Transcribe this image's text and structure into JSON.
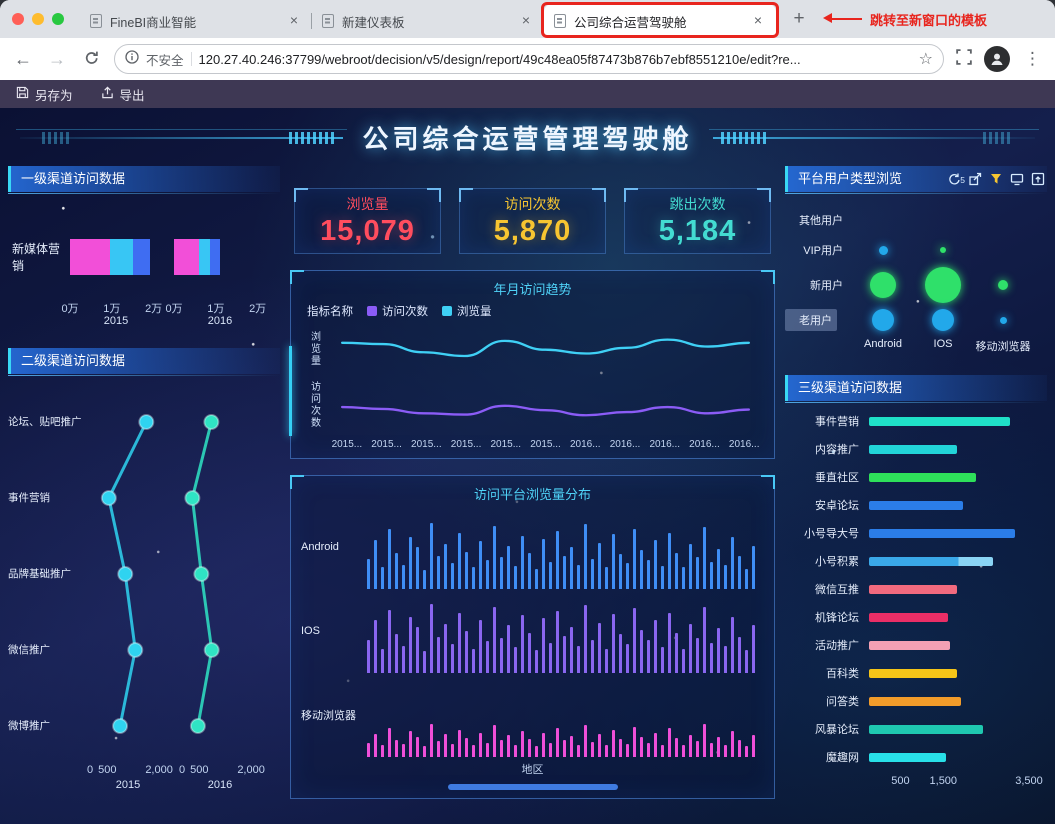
{
  "browser": {
    "window_controls": [
      "close",
      "minimize",
      "zoom"
    ],
    "tabs": [
      {
        "label": "FineBI商业智能",
        "active": false,
        "highlighted": false
      },
      {
        "label": "新建仪表板",
        "active": false,
        "highlighted": false
      },
      {
        "label": "公司综合运营驾驶舱",
        "active": true,
        "highlighted": true
      }
    ],
    "new_tab_label": "+",
    "annotation_text": "跳转至新窗口的模板",
    "address": {
      "security_label": "不安全",
      "url": "120.27.40.246:37799/webroot/decision/v5/design/report/49c48ea05f87473b876b7ebf8551210e/edit?re..."
    },
    "icons": [
      "back-icon",
      "forward-icon",
      "reload-icon",
      "info-icon",
      "bookmark-star-icon",
      "fullscreen-icon",
      "profile-avatar",
      "menu-icon"
    ]
  },
  "app_toolbar": {
    "save_as_label": "另存为",
    "export_label": "导出"
  },
  "dashboard": {
    "title": "公司综合运营管理驾驶舱",
    "kpis": [
      {
        "label": "浏览量",
        "value": "15,079",
        "color": "#ff4d5e"
      },
      {
        "label": "访问次数",
        "value": "5,870",
        "color": "#f7c531"
      },
      {
        "label": "跳出次数",
        "value": "5,184",
        "color": "#43dcd1"
      }
    ],
    "level1_panel": {
      "title": "一级渠道访问数据",
      "chart_data": {
        "type": "bar",
        "orientation": "horizontal",
        "stacked": true,
        "category": "新媒体营销",
        "xlim": [
          0,
          2.2
        ],
        "ticks": [
          {
            "label": "0万",
            "value": 0
          },
          {
            "label": "1万",
            "value": 1
          },
          {
            "label": "2万",
            "value": 2
          }
        ],
        "series_colors": [
          "#f24fd8",
          "#38c6f4",
          "#3f6df2"
        ],
        "groups": [
          {
            "year": "2015",
            "values": [
              0.95,
              0.55,
              0.42
            ]
          },
          {
            "year": "2016",
            "values": [
              0.6,
              0.26,
              0.24
            ]
          }
        ]
      }
    },
    "level2_panel": {
      "title": "二级渠道访问数据",
      "chart_data": {
        "type": "scatter",
        "categories": [
          "论坛、贴吧推广",
          "事件营销",
          "品牌基础推广",
          "微信推广",
          "微博推广"
        ],
        "xlim": [
          0,
          2200
        ],
        "ticks": [
          {
            "label": "0",
            "value": 0
          },
          {
            "label": "500",
            "value": 500
          },
          {
            "label": "2,000",
            "value": 2000
          }
        ],
        "series": [
          {
            "name": "2015",
            "color": "#2fd3f0",
            "values": [
              1630,
              545,
              1020,
              1310,
              870
            ]
          },
          {
            "name": "2016",
            "color": "#2fe4c4",
            "values": [
              850,
              300,
              560,
              860,
              460
            ]
          }
        ]
      }
    },
    "trend_panel": {
      "title": "年月访问趋势",
      "legend_title": "指标名称",
      "y_axis_labels": [
        "浏览量",
        "访问次数"
      ],
      "chart_data": {
        "type": "line",
        "x_labels": [
          "2015...",
          "2015...",
          "2015...",
          "2015...",
          "2015...",
          "2015...",
          "2016...",
          "2016...",
          "2016...",
          "2016...",
          "2016..."
        ],
        "ylim": [
          0,
          1600
        ],
        "series": [
          {
            "name": "访问次数",
            "color": "#8b5cf6",
            "values": [
              430,
              400,
              330,
              310,
              450,
              380,
              300,
              350,
              430,
              330,
              390
            ]
          },
          {
            "name": "浏览量",
            "color": "#3fd0f5",
            "values": [
              1450,
              1430,
              1300,
              1240,
              1480,
              1340,
              1280,
              1370,
              1500,
              1390,
              1450
            ]
          }
        ]
      }
    },
    "platform_panel": {
      "title": "访问平台浏览量分布",
      "xlabel": "地区",
      "chart_data": {
        "type": "bar",
        "value_unit": "relative height 0-100",
        "rows": [
          {
            "label": "Android",
            "color": "#3f8ef5",
            "values": [
              42,
              68,
              30,
              84,
              50,
              34,
              72,
              58,
              26,
              92,
              46,
              62,
              36,
              78,
              52,
              30,
              66,
              40,
              88,
              44,
              60,
              32,
              74,
              50,
              28,
              70,
              38,
              80,
              46,
              58,
              34,
              90,
              42,
              64,
              30,
              76,
              48,
              36,
              84,
              54,
              40,
              68,
              32,
              78,
              50,
              30,
              62,
              44,
              86,
              38,
              56,
              34,
              72,
              46,
              28,
              60
            ]
          },
          {
            "label": "IOS",
            "color": "#8a66f0",
            "values": [
              46,
              74,
              34,
              88,
              54,
              38,
              78,
              64,
              30,
              96,
              50,
              68,
              40,
              84,
              58,
              34,
              74,
              44,
              92,
              48,
              66,
              36,
              80,
              56,
              32,
              76,
              42,
              86,
              52,
              64,
              38,
              94,
              46,
              70,
              34,
              82,
              54,
              40,
              90,
              60,
              46,
              74,
              36,
              84,
              56,
              34,
              68,
              48,
              92,
              42,
              62,
              38,
              78,
              50,
              32,
              66
            ]
          },
          {
            "label": "移动浏览器",
            "color": "#ef4fd8",
            "values": [
              20,
              32,
              16,
              40,
              24,
              18,
              36,
              28,
              15,
              46,
              22,
              32,
              18,
              38,
              26,
              16,
              34,
              20,
              44,
              23,
              30,
              17,
              36,
              25,
              15,
              34,
              19,
              40,
              24,
              29,
              17,
              44,
              21,
              32,
              16,
              38,
              25,
              18,
              42,
              28,
              20,
              34,
              17,
              40,
              26,
              16,
              31,
              22,
              46,
              19,
              28,
              17,
              36,
              23,
              15,
              30
            ]
          }
        ]
      }
    },
    "user_type_panel": {
      "title": "平台用户类型浏览",
      "toolbar_icons": [
        {
          "name": "refresh-icon",
          "badge": "5"
        },
        {
          "name": "open-window-icon"
        },
        {
          "name": "filter-icon",
          "color": "#f5c531"
        },
        {
          "name": "export-icon"
        },
        {
          "name": "collapse-icon"
        }
      ],
      "chart_data": {
        "type": "scatter",
        "rows": [
          "其他用户",
          "VIP用户",
          "新用户",
          "老用户"
        ],
        "selected_row": "老用户",
        "cols": [
          "Android",
          "IOS",
          "移动浏览器"
        ],
        "bubbles": [
          {
            "row": 1,
            "col": 0,
            "size": 9,
            "color": "#22a8ea"
          },
          {
            "row": 1,
            "col": 1,
            "size": 6,
            "color": "#2fe06a"
          },
          {
            "row": 2,
            "col": 0,
            "size": 26,
            "color": "#2fe06a"
          },
          {
            "row": 2,
            "col": 1,
            "size": 36,
            "color": "#2fe06a"
          },
          {
            "row": 2,
            "col": 2,
            "size": 10,
            "color": "#2fe06a"
          },
          {
            "row": 3,
            "col": 0,
            "size": 22,
            "color": "#22a8ea"
          },
          {
            "row": 3,
            "col": 1,
            "size": 22,
            "color": "#22a8ea"
          },
          {
            "row": 3,
            "col": 2,
            "size": 7,
            "color": "#22a8ea"
          }
        ]
      }
    },
    "level3_panel": {
      "title": "三级渠道访问数据",
      "chart_data": {
        "type": "bar",
        "orientation": "horizontal",
        "xlim": [
          0,
          3500
        ],
        "ticks": [
          {
            "label": "500",
            "value": 500
          },
          {
            "label": "1,500",
            "value": 1500
          },
          {
            "label": "3,500",
            "value": 3500
          }
        ],
        "items": [
          {
            "label": "事件营销",
            "value": 3300,
            "color": "#1fe0c8"
          },
          {
            "label": "内容推广",
            "value": 2050,
            "color": "#22d4d8"
          },
          {
            "label": "垂直社区",
            "value": 2500,
            "color": "#2ee05a"
          },
          {
            "label": "安卓论坛",
            "value": 2200,
            "color": "#2b7de8"
          },
          {
            "label": "小号导大号",
            "value": 3400,
            "color": "#2b7de8"
          },
          {
            "label": "小号积累",
            "value": 2900,
            "color": "#3aa8e8",
            "color2": "#8ad4f4"
          },
          {
            "label": "微信互推",
            "value": 2050,
            "color": "#f26a7e"
          },
          {
            "label": "机锋论坛",
            "value": 1850,
            "color": "#ea2e66"
          },
          {
            "label": "活动推广",
            "value": 1900,
            "color": "#f4a0b4"
          },
          {
            "label": "百科类",
            "value": 2050,
            "color": "#f5c518"
          },
          {
            "label": "问答类",
            "value": 2150,
            "color": "#f29c2a"
          },
          {
            "label": "风暴论坛",
            "value": 2650,
            "color": "#1fc8b0"
          },
          {
            "label": "魔趣网",
            "value": 1800,
            "color": "#28e0e8"
          }
        ]
      }
    }
  }
}
